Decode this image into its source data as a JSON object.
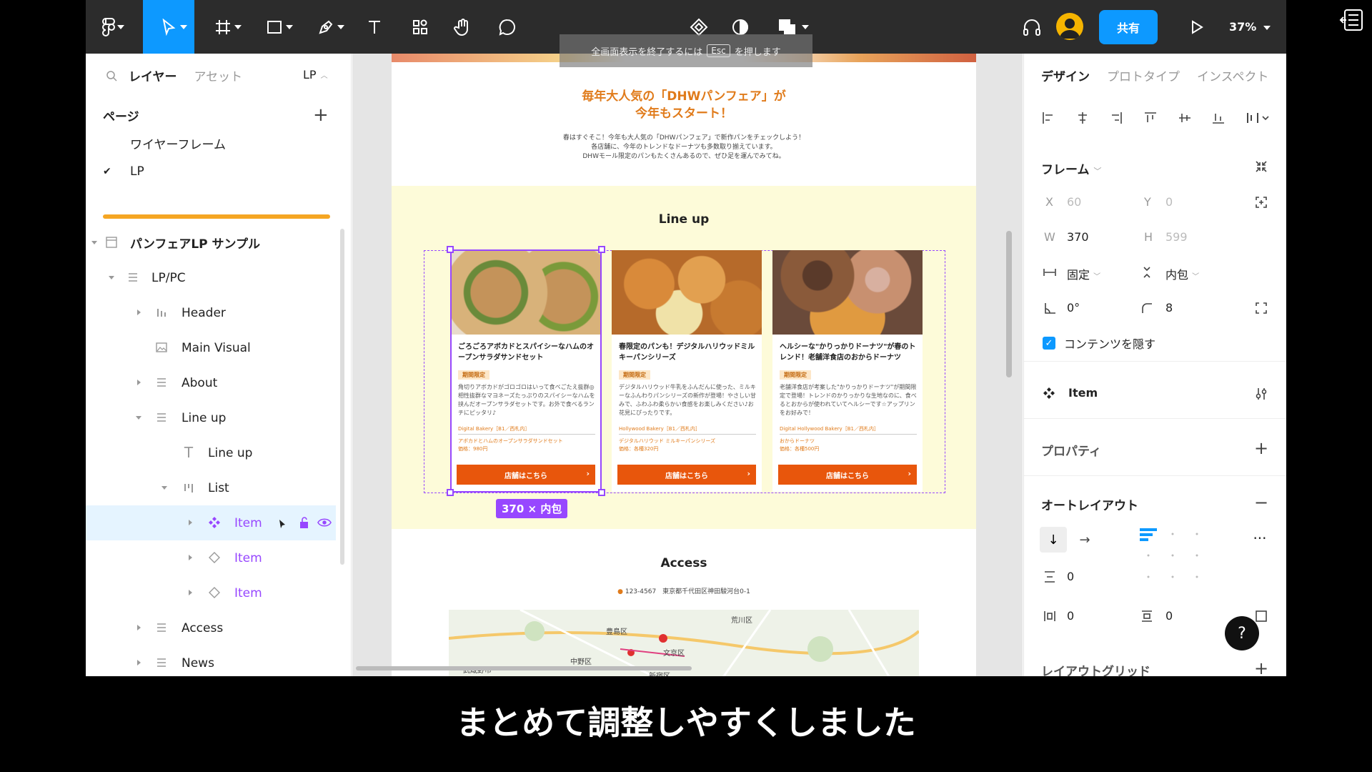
{
  "toolbar": {
    "share_label": "共有",
    "zoom_label": "37%",
    "esc_hint_prefix": "全画面表示を終了するには",
    "esc_key": "Esc",
    "esc_hint_suffix": "を押します"
  },
  "left_panel": {
    "tab_layers": "レイヤー",
    "tab_assets": "アセット",
    "page_selector": "LP",
    "pages_heading": "ページ",
    "pages": [
      "ワイヤーフレーム",
      "LP"
    ],
    "layers": [
      {
        "label": "パンフェアLP サンプル"
      },
      {
        "label": "LP/PC"
      },
      {
        "label": "Header"
      },
      {
        "label": "Main Visual"
      },
      {
        "label": "About"
      },
      {
        "label": "Line up"
      },
      {
        "label": "Line up"
      },
      {
        "label": "List"
      },
      {
        "label": "Item"
      },
      {
        "label": "Item"
      },
      {
        "label": "Item"
      },
      {
        "label": "Access"
      },
      {
        "label": "News"
      }
    ]
  },
  "canvas": {
    "fair_title_line1": "毎年大人気の「DHWパンフェア」が",
    "fair_title_line2": "今年もスタート！",
    "fair_desc_line1": "春はすぐそこ！今年も大人気の「DHWパンフェア」で新作パンをチェックしよう！",
    "fair_desc_line2": "各店舗に、今年のトレンドなドーナツも多数取り揃えています。",
    "fair_desc_line3": "DHWモール限定のパンもたくさんあるので、ぜひ足を運んでみてね。",
    "lineup_title": "Line up",
    "cards": [
      {
        "title": "ごろごろアボカドとスパイシーなハムのオープンサラダサンドセット",
        "badge": "期間限定",
        "body": "角切りアボカドがゴロゴロはいって食べごたえ抜群◎相性抜群なマヨネーズたっぷりのスパイシーなハムを挟んだオープンサラダセットです。お外で食べるランチにピッタリ♪",
        "shop": "Digital Bakery［B1／西札内］",
        "menu1": "アボカドとハムのオープンサラダサンドセット",
        "menu2": "価格：980円",
        "button": "店舗はこちら"
      },
      {
        "title": "春限定のパンも！デジタルハリウッドミルキーパンシリーズ",
        "badge": "期間限定",
        "body": "デジタルハリウッド牛乳をふんだんに使った、ミルキーなふんわりパンシリーズの新作が登場！やさしい甘みで、ふわふわ柔らかい食感をお楽しみください♪お花見にぴったりです。",
        "shop": "Hollywood Bakery［B1／西札内］",
        "menu1": "デジタルハリウッド ミルキーパンシリーズ",
        "menu2": "価格：各種320円",
        "button": "店舗はこちら"
      },
      {
        "title": "ヘルシーな\"かりっかりドーナツ\"が春のトレンド！老舗洋食店のおからドーナツ",
        "badge": "期間限定",
        "body": "老舗洋食店が考案した\"かりっかりドーナツ\"が期間限定で登場！トレンドのかりっかりな生地なのに、食べるとおからが使われていてヘルシーです☆アップリンをお好みで！",
        "shop": "Digital Hollywood Bakery［B1／西札内］",
        "menu1": "おからドーナツ",
        "menu2": "価格：各種500円",
        "button": "店舗はこちら"
      }
    ],
    "size_tag": "370 × 内包",
    "access_title": "Access",
    "access_address": "123-4567　東京都千代田区神田駿河台0-1",
    "map_labels": [
      "荒川区",
      "豊島区",
      "文京区",
      "中野区",
      "新宿区",
      "武蔵野市"
    ]
  },
  "right_panel": {
    "tab_design": "デザイン",
    "tab_prototype": "プロトタイプ",
    "tab_inspect": "インスペクト",
    "frame_heading": "フレーム",
    "x_label": "X",
    "x_value": "60",
    "y_label": "Y",
    "y_value": "0",
    "w_label": "W",
    "w_value": "370",
    "h_label": "H",
    "h_value": "599",
    "width_mode": "固定",
    "height_mode": "内包",
    "rotation": "0°",
    "radius": "8",
    "clip_content": "コンテンツを隠す",
    "component_name": "Item",
    "properties_heading": "プロパティ",
    "autolayout_heading": "オートレイアウト",
    "spacing": "0",
    "padding_h": "0",
    "padding_v": "0",
    "layout_grid_heading": "レイアウトグリッド"
  },
  "subtitle": "まとめて調整しやすくしました",
  "colors": {
    "accent": "#0d99ff",
    "component": "#9747ff",
    "toolbar_bg": "#2c2c2c",
    "orange": "#e8560c"
  }
}
